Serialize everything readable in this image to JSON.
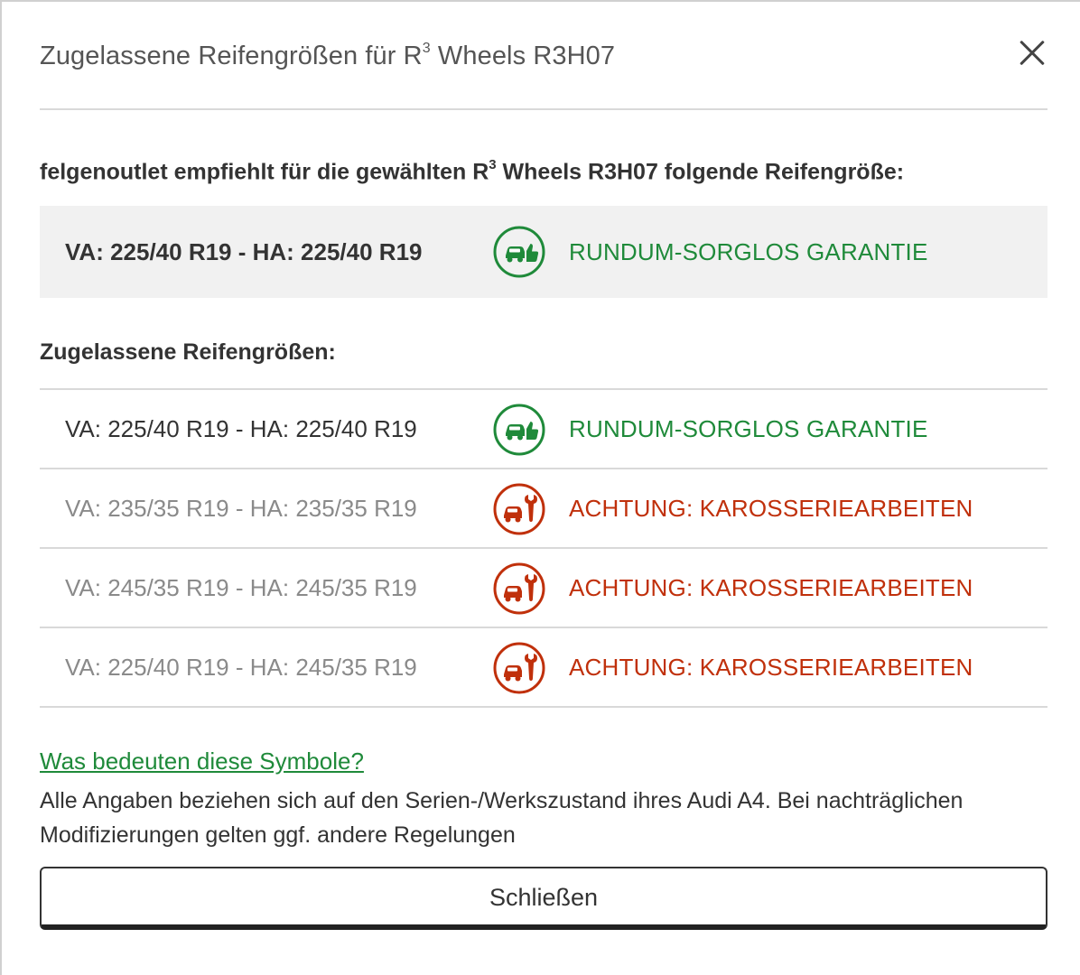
{
  "dialog": {
    "title_prefix": "Zugelassene Reifengrößen für R",
    "title_sup": "3",
    "title_suffix": " Wheels R3H07"
  },
  "recommendation": {
    "heading_prefix": "felgenoutlet empfiehlt für die gewählten R",
    "heading_sup": "3",
    "heading_suffix": " Wheels R3H07 folgende Reifengröße:",
    "size": "VA: 225/40 R19 - HA: 225/40 R19",
    "badge_text": "RUNDUM-SORGLOS GARANTIE",
    "badge_icon": "car-thumbs-up-icon",
    "badge_color": "#1f8a3a"
  },
  "approved": {
    "heading": "Zugelassene Reifengrößen:",
    "rows": [
      {
        "size": "VA: 225/40 R19 - HA: 225/40 R19",
        "badge_text": "RUNDUM-SORGLOS GARANTIE",
        "status": "ok"
      },
      {
        "size": "VA: 235/35 R19 - HA: 235/35 R19",
        "badge_text": "ACHTUNG: KAROSSERIEARBEITEN",
        "status": "warn"
      },
      {
        "size": "VA: 245/35 R19 - HA: 245/35 R19",
        "badge_text": "ACHTUNG: KAROSSERIEARBEITEN",
        "status": "warn"
      },
      {
        "size": "VA: 225/40 R19 - HA: 245/35 R19",
        "badge_text": "ACHTUNG: KAROSSERIEARBEITEN",
        "status": "warn"
      }
    ]
  },
  "footer": {
    "symbols_link": "Was bedeuten diese Symbole?",
    "disclaimer": "Alle Angaben beziehen sich auf den Serien-/Werkszustand ihres Audi A4. Bei nachträglichen Modifizierungen gelten ggf. andere Regelungen",
    "close_button_label": "Schließen"
  },
  "colors": {
    "ok": "#1f8a3a",
    "warn": "#c0300b"
  },
  "icons": {
    "ok": "car-thumbs-up-icon",
    "warn": "car-wrench-icon",
    "close": "close-icon"
  }
}
